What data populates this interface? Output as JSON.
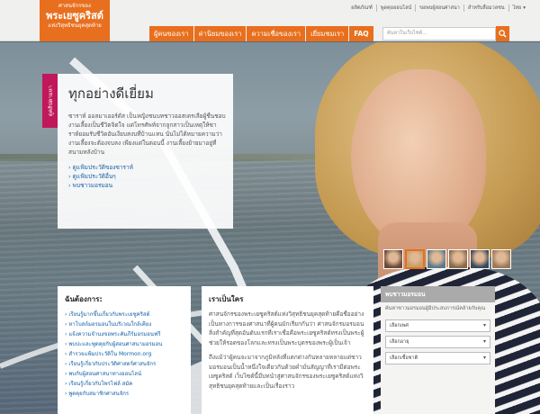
{
  "header": {
    "logo_line1": "ศาสนจักรของ",
    "logo_line2": "พระเยซูคริสต์",
    "logo_line3": "แห่งวิสุทธิชนยุคสุดท้าย",
    "top_links": [
      "ผลิตภัณฑ์",
      "พูดคุยออนไลน์",
      "ขอพบผู้สอนศาสนา",
      "สำหรับสื่อมวลชน"
    ],
    "language": "ไทย",
    "nav": [
      "ผู้คนของเรา",
      "ค่านิยมของเรา",
      "ความเชื่อของเรา",
      "เยี่ยมชมเรา",
      "FAQ"
    ],
    "search_placeholder": "ค้นหาในเว็บไซต์..."
  },
  "hero": {
    "tab_label": "ดูคลิปตามหา",
    "title": "ทุกอย่างดีเยี่ยม",
    "body": "ซาราห์ ออลมาเออร์ดัส เป็นหญิงชนบทชาวออสเตรเลียผู้ชื่นชอบงานเลี้ยงเป็นชีวิตจิตใจ แต่โทรศัพท์จากลูกสาวเป็นเหตุให้ซาราห์ยอมรับชีวิตอันเงียบสงบที่บ้านแทน นั่นไม่ได้หมายความว่างานเลี้ยงจะต้องจบลง เพียงแต่ในตอนนี้ งานเลี้ยงย้ายมาอยู่ที่สนามหลังบ้าน",
    "links": [
      "ดูแฟ้มประวัติของซาราห์",
      "ดูแฟ้มประวัติอื่นๆ",
      "พบชาวมอรมอน"
    ]
  },
  "thumbs": [
    {
      "color": "#6b4a3a",
      "selected": false
    },
    {
      "color": "#c7a06a",
      "selected": true
    },
    {
      "color": "#5d7a8a",
      "selected": false
    },
    {
      "color": "#8a6a4a",
      "selected": false
    },
    {
      "color": "#3a4a5a",
      "selected": false
    },
    {
      "color": "#9a7a5a",
      "selected": false
    }
  ],
  "panel_left": {
    "title": "ฉันต้องการ:",
    "links": [
      "เรียนรู้มากขึ้นเกี่ยวกับพระเยซูคริสต์",
      "หาโบสถ์มอรมอนในบริเวณใกล้เคียง",
      "แจ้งความจำนงขอพระคัมภีร์มอรมอนฟรี",
      "พบปะและพูดคุยกับผู้สอนศาสนามอรมอน",
      "สำรวจแฟ้มประวัติใน Mormon.org",
      "เรียนรู้เกี่ยวกับประวัติศาสตร์ศาสนจักร",
      "พบกับผู้สอนศาสนาทางออนไลน์",
      "เรียนรู้เกี่ยวกับโพรไฟล์ สมัค",
      "พูดคุยกับสมาชิกศาสนจักร"
    ]
  },
  "panel_mid": {
    "title": "เราเป็นใคร",
    "p1": "ศาสนจักรของพระเยซูคริสต์แห่งวิสุทธิชนยุคสุดท้ายคือชื่ออย่างเป็นทางการของศาสนาที่ผู้คนมักเรียกกันว่า ศาสนจักรมอรมอน สิ่งสำคัญที่สุดอันดับแรกที่เราเชื่อคือพระเยซูคริสต์ทรงเป็นพระผู้ช่วยให้รอดของโลกและทรงเป็นพระบุตรของพระผู้เป็นเจ้า",
    "p2": "ถึงแม้ว่าผู้คนจะมาจากภูมิหลังที่แตกต่างกันหลายหลายแต่ชาวมอรมอนเป็นน้ำหนึ่งใจเดียวกันด้วยคำมั่นสัญญาที่เรามีต่อพระเยซูคริสต์ เว็บไซต์นี้มีบทนำสู่ศาสนจักรของพระเยซูคริสต์แห่งวิสุทธิชนยุคสุดท้ายและเป็นเรื่องราว"
  },
  "panel_right": {
    "title": "พบชาวมอรมอน",
    "desc": "ค้นหาชาวมอรมอนผู้มีประสบการณ์คล้ายกับคุณ",
    "select_gender": "เลือกเพศ",
    "select_age": "เลือกอายุ",
    "select_ethnicity": "เลือกเชื้อชาติ"
  },
  "colors": {
    "accent": "#e86f1e",
    "magenta": "#c0185a",
    "link": "#1560a6"
  }
}
